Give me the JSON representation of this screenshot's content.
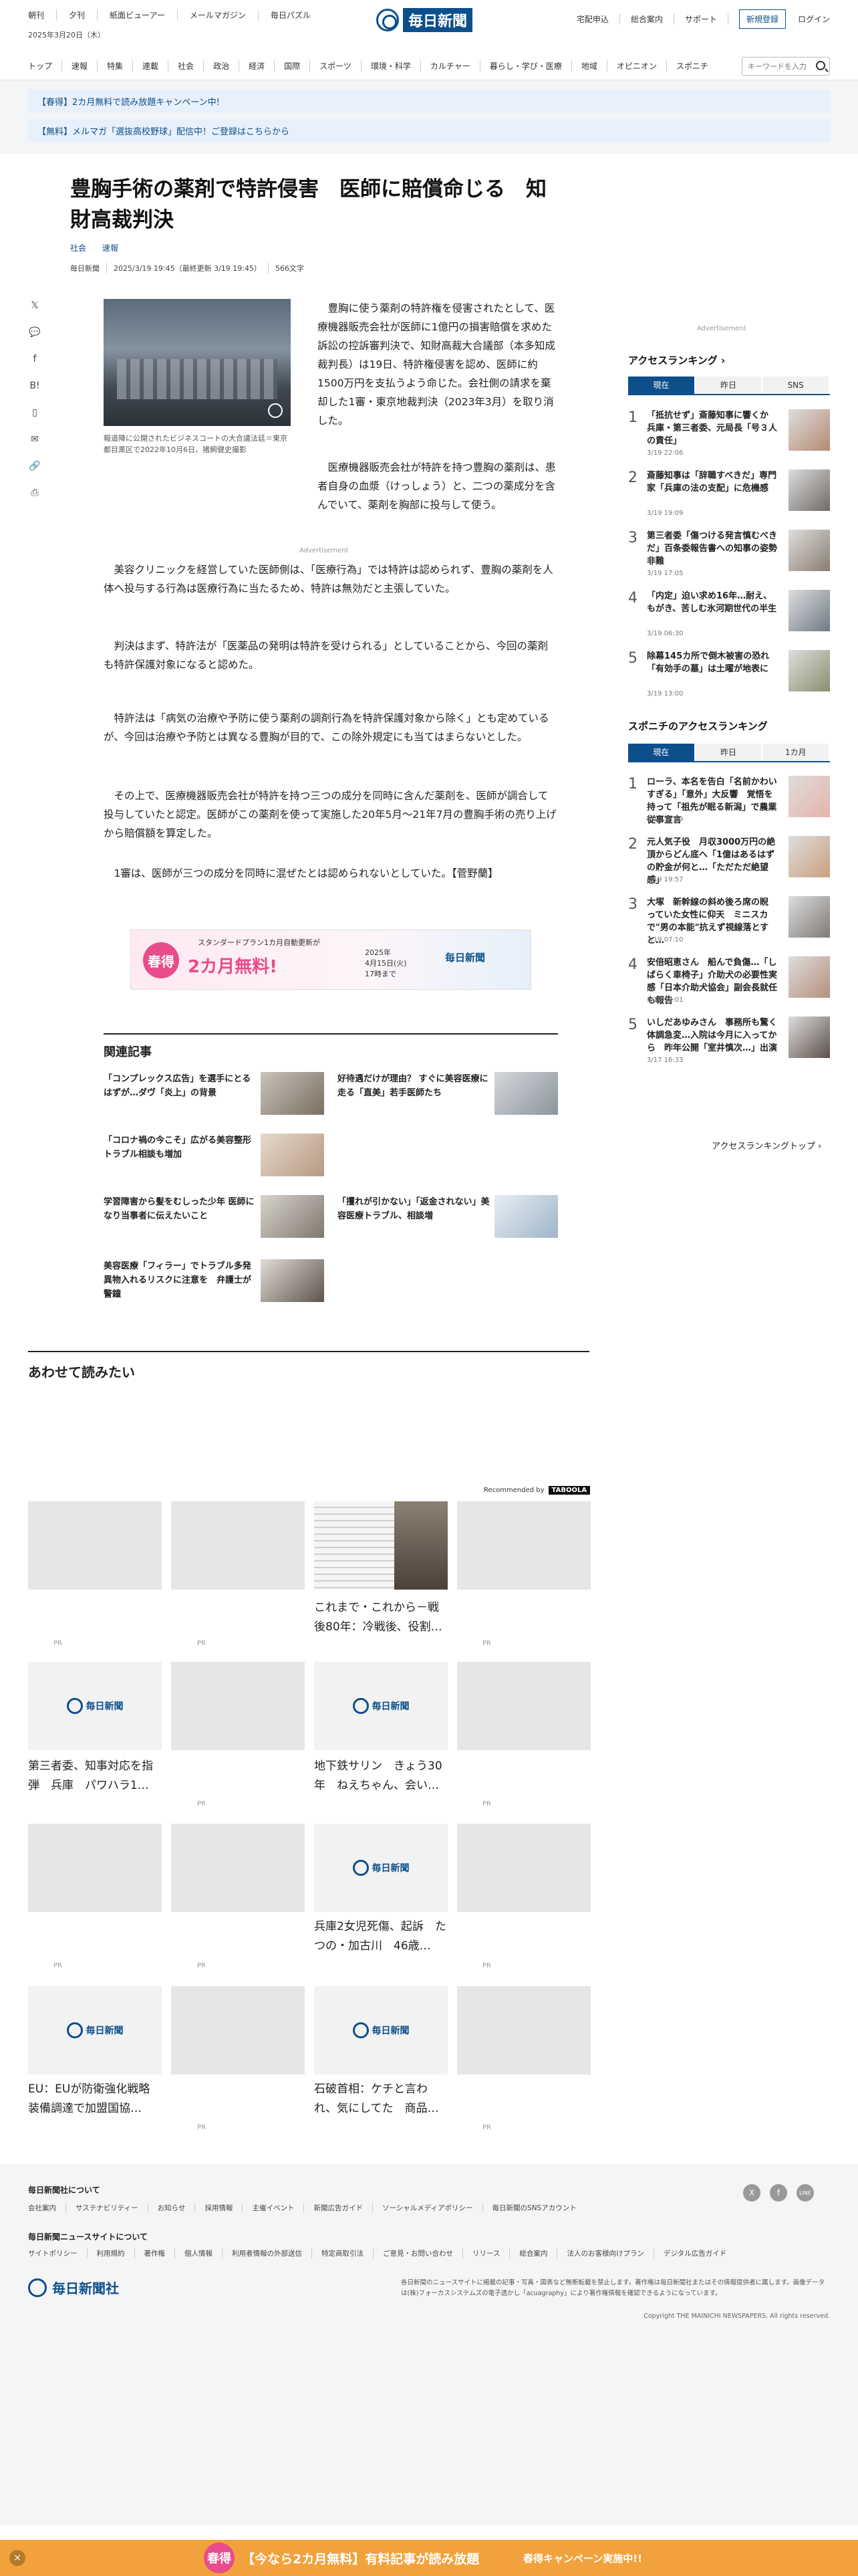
{
  "header": {
    "top_links": [
      "朝刊",
      "夕刊",
      "紙面ビューアー",
      "メールマガジン",
      "毎日パズル"
    ],
    "date": "2025年3月20日（木）",
    "logo_text": "毎日新聞",
    "right_links": [
      "宅配申込",
      "総合案内",
      "サポート"
    ],
    "register_label": "新規登録",
    "login_label": "ログイン"
  },
  "categories": [
    "トップ",
    "速報",
    "特集",
    "連載",
    "社会",
    "政治",
    "経済",
    "国際",
    "スポーツ",
    "環境・科学",
    "カルチャー",
    "暮らし・学び・医療",
    "地域",
    "オピニオン",
    "スポニチ"
  ],
  "search": {
    "placeholder": "キーワードを入力"
  },
  "promos": [
    "【春得】2カ月無料で読み放題キャンペーン中!",
    "【無料】メルマガ「選抜高校野球」配信中！ご登録はこちらから"
  ],
  "article": {
    "headline": "豊胸手術の薬剤で特許侵害　医師に賠償命じる　知財高裁判決",
    "tags": [
      "社会",
      "速報"
    ],
    "meta": [
      "毎日新聞",
      "2025/3/19 19:45（最終更新 3/19 19:45）",
      "566文字"
    ],
    "caption": "報道陣に公開されたビジネスコートの大合議法廷＝東京都目黒区で2022年10月6日、猪飼健史撮影",
    "paragraphs": [
      "　豊胸に使う薬剤の特許権を侵害されたとして、医療機器販売会社が医師に1億円の損害賠償を求めた訴訟の控訴審判決で、知財高裁大合議部（本多知成裁判長）は19日、特許権侵害を認め、医師に約1500万円を支払うよう命じた。会社側の請求を棄却した1審・東京地裁判決（2023年3月）を取り消した。",
      "　医療機器販売会社が特許を持つ豊胸の薬剤は、患者自身の血漿（けっしょう）と、二つの薬成分を含んでいて、薬剤を胸部に投与して使う。",
      "　美容クリニックを経営していた医師側は、「医療行為」では特許は認められず、豊胸の薬剤を人体へ投与する行為は医療行為に当たるため、特許は無効だと主張していた。",
      "　判決はまず、特許法が「医薬品の発明は特許を受けられる」としていることから、今回の薬剤も特許保護対象になると認めた。",
      "　特許法は「病気の治療や予防に使う薬剤の調剤行為を特許保護対象から除く」とも定めているが、今回は治療や予防とは異なる豊胸が目的で、この除外規定にも当てはまらないとした。",
      "　その上で、医療機器販売会社が特許を持つ三つの成分を同時に含んだ薬剤を、医師が調合して投与していたと認定。医師がこの薬剤を使って実施した20年5月～21年7月の豊胸手術の売り上げから賠償額を算定した。",
      "　1審は、医師が三つの成分を同時に混ぜたとは認められないとしていた。【菅野蘭】"
    ],
    "ad_label": "Advertisement"
  },
  "banner": {
    "line1": "スタンダードプラン1カ月自動更新が",
    "badge": "春得",
    "main": "2カ月無料!",
    "date": "2025年\n4月15日(火)\n17時まで",
    "logo": "毎日新聞"
  },
  "related": {
    "heading": "関連記事",
    "items": [
      "「コンプレックス広告」を選手にとるはずが…ダヴ「炎上」の背景",
      "好待遇だけが理由？ すぐに美容医療に走る「直美」若手医師たち",
      "「コロナ禍の今こそ」広がる美容整形 トラブル相談も増加",
      "「攫れが引かない」「返金されない」美容医療トラブル、相談増",
      "学習障害から髪をむしった少年 医師になり当事者に伝えたいこと",
      "美容医療「フィラー」でトラブル多発　異物入れるリスクに注意を　弁護士が警鐘"
    ]
  },
  "read_together": {
    "heading": "あわせて読みたい",
    "recommended": "Recommended by",
    "taboola": "TABOOLA",
    "logo": "毎日新聞",
    "pr": "PR",
    "titles": [
      "これまで・これから－戦後80年：冷戦後、役割…",
      "第三者委、知事対応を指弾　兵庫　パワハラ1…",
      "地下鉄サリン　きょう30年　ねえちゃん、会い…",
      "兵庫2女児死傷、起訴　たつの・加古川　46歳…",
      "EU：EUが防衛強化戦略　装備調達で加盟国協…",
      "石破首相：ケチと言われ、気にしてた　商品…"
    ]
  },
  "sidebar": {
    "ad_label": "Advertisement",
    "ranking_title": "アクセスランキング",
    "tabs": [
      "現在",
      "昨日",
      "SNS"
    ],
    "ranking": [
      {
        "t": "「抵抗せず」斎藤知事に響くか 兵庫・第三者委、元局長「号３人の責任」",
        "d": "3/19 22:06"
      },
      {
        "t": "斎藤知事は「辞職すべきだ」専門家「兵庫の法の支配」に危機感",
        "d": "3/19 19:09"
      },
      {
        "t": "第三者委「傷つける発言慎むべきだ」百条委報告書への知事の姿勢非難",
        "d": "3/19 17:05"
      },
      {
        "t": "「内定」迫い求め16年…耐え、もがき、苦しむ氷河期世代の半生",
        "d": "3/19 06:30"
      },
      {
        "t": "除幕145カ所で倒木被害の恐れ「有効手の墓」は土曜が地表に",
        "d": "3/19 13:00"
      }
    ],
    "sponichi_title": "スポニチのアクセスランキング",
    "sponichi_tabs": [
      "現在",
      "昨日",
      "1カ月"
    ],
    "sponichi": [
      {
        "t": "ローラ、本名を告白「名前かわいすぎる」「意外」大反響　覚悟を持って「祖先が眠る新潟」で農業従事宣言",
        "d": "3/19 13:09"
      },
      {
        "t": "元人気子役　月収3000万円の絶頂からどん底へ「1億はあるはずの貯金が何と…「ただただ絶望感」",
        "d": "3/19 19:57"
      },
      {
        "t": "大塚　新幹線の斜め後ろ席の睨っていた女性に仰天　ミニスカで\"男の本能\"抗えず視線落とすと…",
        "d": "3/19 07:10"
      },
      {
        "t": "安倍昭恵さん　船んで負傷…「しばらく車椅子」介助犬の必要性実感「日本介助犬協会」副会長就任も報告",
        "d": "3/19 18:01"
      },
      {
        "t": "いしだあゆみさん　事務所も驚く体調急変…入院は今月に入ってから　昨年公開「室井慎次…」出演",
        "d": "3/17 16:33"
      }
    ],
    "ranking_more": "アクセスランキングトップ"
  },
  "footer": {
    "company_heading": "毎日新聞社について",
    "company_links": [
      "会社案内",
      "サステナビリティー",
      "お知らせ",
      "採用情報",
      "主催イベント",
      "新聞広告ガイド",
      "ソーシャルメディアポリシー",
      "毎日新聞のSNSアカウント"
    ],
    "site_heading": "毎日新聞ニュースサイトについて",
    "site_links": [
      "サイトポリシー",
      "利用規約",
      "著作権",
      "個人情報",
      "利用者情報の外部送信",
      "特定商取引法",
      "ご意見・お問い合わせ",
      "リリース",
      "総合案内",
      "法人のお客様向けプラン",
      "デジタル広告ガイド"
    ],
    "logo": "毎日新聞社",
    "note": "各日新聞のニュースサイトに掲載の記事・写真・図表など無断転載を禁止します。著作権は毎日新聞社またはその情報提供者に属します。画像データは(株)フォーカスシステムズの電子透かし「acuagraphy」により著作権情報を確認できるようになっています。",
    "copyright": "Copyright THE MAINICHI NEWSPAPERS. All rights reserved.",
    "social": [
      "X",
      "f",
      "LINE"
    ]
  },
  "bottom_bar": {
    "badge": "春得",
    "message": "【今なら2カ月無料】有料記事が読み放題",
    "sub": "春得キャンペーン実施中!!"
  }
}
